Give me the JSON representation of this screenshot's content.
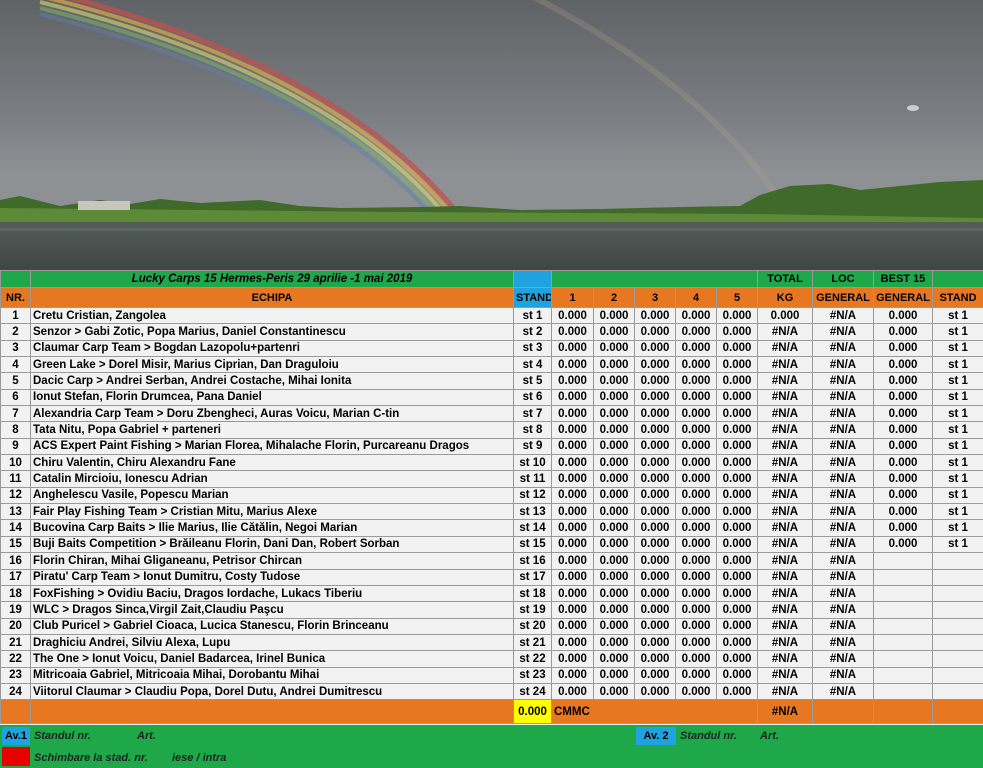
{
  "header": {
    "title": "Lucky Carps 15 Hermes-Peris 29 aprilie -1 mai 2019",
    "total": "TOTAL",
    "loc": "LOC",
    "best": "BEST 15"
  },
  "columns": {
    "nr": "NR.",
    "echipa": "ECHIPA",
    "stand": "STAND",
    "s1": "1",
    "s2": "2",
    "s3": "3",
    "s4": "4",
    "s5": "5",
    "kg": "KG",
    "general1": "GENERAL",
    "general2": "GENERAL",
    "stand2": "STAND"
  },
  "rows": [
    {
      "nr": "1",
      "team": "Cretu Cristian, Zangolea",
      "stand": "st 1",
      "s1": "0.000",
      "s2": "0.000",
      "s3": "0.000",
      "s4": "0.000",
      "s5": "0.000",
      "kg": "0.000",
      "loc": "#N/A",
      "best": "0.000",
      "stand2": "st 1"
    },
    {
      "nr": "2",
      "team": "Senzor > Gabi Zotic, Popa Marius, Daniel Constantinescu",
      "stand": "st 2",
      "s1": "0.000",
      "s2": "0.000",
      "s3": "0.000",
      "s4": "0.000",
      "s5": "0.000",
      "kg": "#N/A",
      "loc": "#N/A",
      "best": "0.000",
      "stand2": "st 1"
    },
    {
      "nr": "3",
      "team": "Claumar Carp Team > Bogdan Lazopolu+partenri",
      "stand": "st 3",
      "s1": "0.000",
      "s2": "0.000",
      "s3": "0.000",
      "s4": "0.000",
      "s5": "0.000",
      "kg": "#N/A",
      "loc": "#N/A",
      "best": "0.000",
      "stand2": "st 1"
    },
    {
      "nr": "4",
      "team": "Green Lake > Dorel Misir, Marius Ciprian, Dan Draguloiu",
      "stand": "st 4",
      "s1": "0.000",
      "s2": "0.000",
      "s3": "0.000",
      "s4": "0.000",
      "s5": "0.000",
      "kg": "#N/A",
      "loc": "#N/A",
      "best": "0.000",
      "stand2": "st 1"
    },
    {
      "nr": "5",
      "team": "Dacic Carp > Andrei Serban, Andrei Costache, Mihai Ionita",
      "stand": "st 5",
      "s1": "0.000",
      "s2": "0.000",
      "s3": "0.000",
      "s4": "0.000",
      "s5": "0.000",
      "kg": "#N/A",
      "loc": "#N/A",
      "best": "0.000",
      "stand2": "st 1"
    },
    {
      "nr": "6",
      "team": "Ionut Stefan, Florin Drumcea, Pana Daniel",
      "stand": "st 6",
      "s1": "0.000",
      "s2": "0.000",
      "s3": "0.000",
      "s4": "0.000",
      "s5": "0.000",
      "kg": "#N/A",
      "loc": "#N/A",
      "best": "0.000",
      "stand2": "st 1"
    },
    {
      "nr": "7",
      "team": "Alexandria Carp Team  > Doru Zbengheci, Auras Voicu, Marian C-tin",
      "stand": "st 7",
      "s1": "0.000",
      "s2": "0.000",
      "s3": "0.000",
      "s4": "0.000",
      "s5": "0.000",
      "kg": "#N/A",
      "loc": "#N/A",
      "best": "0.000",
      "stand2": "st 1"
    },
    {
      "nr": "8",
      "team": "Tata Nitu, Popa Gabriel + parteneri",
      "stand": "st 8",
      "s1": "0.000",
      "s2": "0.000",
      "s3": "0.000",
      "s4": "0.000",
      "s5": "0.000",
      "kg": "#N/A",
      "loc": "#N/A",
      "best": "0.000",
      "stand2": "st 1"
    },
    {
      "nr": "9",
      "team": "ACS Expert Paint Fishing  > Marian Florea, Mihalache Florin, Purcareanu Dragos",
      "stand": "st 9",
      "s1": "0.000",
      "s2": "0.000",
      "s3": "0.000",
      "s4": "0.000",
      "s5": "0.000",
      "kg": "#N/A",
      "loc": "#N/A",
      "best": "0.000",
      "stand2": "st 1"
    },
    {
      "nr": "10",
      "team": "Chiru Valentin, Chiru Alexandru Fane",
      "stand": "st 10",
      "s1": "0.000",
      "s2": "0.000",
      "s3": "0.000",
      "s4": "0.000",
      "s5": "0.000",
      "kg": "#N/A",
      "loc": "#N/A",
      "best": "0.000",
      "stand2": "st 1"
    },
    {
      "nr": "11",
      "team": "Catalin Mircioiu, Ionescu Adrian",
      "stand": "st 11",
      "s1": "0.000",
      "s2": "0.000",
      "s3": "0.000",
      "s4": "0.000",
      "s5": "0.000",
      "kg": "#N/A",
      "loc": "#N/A",
      "best": "0.000",
      "stand2": "st 1"
    },
    {
      "nr": "12",
      "team": "Anghelescu Vasile, Popescu Marian",
      "stand": "st 12",
      "s1": "0.000",
      "s2": "0.000",
      "s3": "0.000",
      "s4": "0.000",
      "s5": "0.000",
      "kg": "#N/A",
      "loc": "#N/A",
      "best": "0.000",
      "stand2": "st 1"
    },
    {
      "nr": "13",
      "team": "Fair Play Fishing Team > Cristian Mitu, Marius Alexe",
      "stand": "st 13",
      "s1": "0.000",
      "s2": "0.000",
      "s3": "0.000",
      "s4": "0.000",
      "s5": "0.000",
      "kg": "#N/A",
      "loc": "#N/A",
      "best": "0.000",
      "stand2": "st 1"
    },
    {
      "nr": "14",
      "team": "Bucovina Carp Baits  > Ilie Marius, Ilie Cătălin, Negoi Marian",
      "stand": "st 14",
      "s1": "0.000",
      "s2": "0.000",
      "s3": "0.000",
      "s4": "0.000",
      "s5": "0.000",
      "kg": "#N/A",
      "loc": "#N/A",
      "best": "0.000",
      "stand2": "st 1"
    },
    {
      "nr": "15",
      "team": "Buji Baits Competition > Brăileanu Florin, Dani Dan, Robert Sorban",
      "stand": "st 15",
      "s1": "0.000",
      "s2": "0.000",
      "s3": "0.000",
      "s4": "0.000",
      "s5": "0.000",
      "kg": "#N/A",
      "loc": "#N/A",
      "best": "0.000",
      "stand2": "st 1"
    },
    {
      "nr": "16",
      "team": "Florin Chiran, Mihai Gliganeanu, Petrisor Chircan",
      "stand": "st 16",
      "s1": "0.000",
      "s2": "0.000",
      "s3": "0.000",
      "s4": "0.000",
      "s5": "0.000",
      "kg": "#N/A",
      "loc": "#N/A",
      "best": "",
      "stand2": ""
    },
    {
      "nr": "17",
      "team": "Piratu' Carp Team  > Ionut Dumitru, Costy Tudose",
      "stand": "st 17",
      "s1": "0.000",
      "s2": "0.000",
      "s3": "0.000",
      "s4": "0.000",
      "s5": "0.000",
      "kg": "#N/A",
      "loc": "#N/A",
      "best": "",
      "stand2": ""
    },
    {
      "nr": "18",
      "team": "FoxFishing > Ovidiu Baciu, Dragos Iordache, Lukacs Tiberiu",
      "stand": "st 18",
      "s1": "0.000",
      "s2": "0.000",
      "s3": "0.000",
      "s4": "0.000",
      "s5": "0.000",
      "kg": "#N/A",
      "loc": "#N/A",
      "best": "",
      "stand2": ""
    },
    {
      "nr": "19",
      "team": "WLC > Dragos Sinca,Virgil Zait,Claudiu Paşcu",
      "stand": "st 19",
      "s1": "0.000",
      "s2": "0.000",
      "s3": "0.000",
      "s4": "0.000",
      "s5": "0.000",
      "kg": "#N/A",
      "loc": "#N/A",
      "best": "",
      "stand2": ""
    },
    {
      "nr": "20",
      "team": "Club Puricel  > Gabriel Cioaca, Lucica Stanescu, Florin Brinceanu",
      "stand": "st 20",
      "s1": "0.000",
      "s2": "0.000",
      "s3": "0.000",
      "s4": "0.000",
      "s5": "0.000",
      "kg": "#N/A",
      "loc": "#N/A",
      "best": "",
      "stand2": ""
    },
    {
      "nr": "21",
      "team": "Draghiciu Andrei, Silviu Alexa, Lupu",
      "stand": "st 21",
      "s1": "0.000",
      "s2": "0.000",
      "s3": "0.000",
      "s4": "0.000",
      "s5": "0.000",
      "kg": "#N/A",
      "loc": "#N/A",
      "best": "",
      "stand2": ""
    },
    {
      "nr": "22",
      "team": "The One  > Ionut Voicu, Daniel Badarcea, Irinel Bunica",
      "stand": "st 22",
      "s1": "0.000",
      "s2": "0.000",
      "s3": "0.000",
      "s4": "0.000",
      "s5": "0.000",
      "kg": "#N/A",
      "loc": "#N/A",
      "best": "",
      "stand2": ""
    },
    {
      "nr": "23",
      "team": "Mitricoaia Gabriel, Mitricoaia Mihai, Dorobantu Mihai",
      "stand": "st 23",
      "s1": "0.000",
      "s2": "0.000",
      "s3": "0.000",
      "s4": "0.000",
      "s5": "0.000",
      "kg": "#N/A",
      "loc": "#N/A",
      "best": "",
      "stand2": ""
    },
    {
      "nr": "24",
      "team": "Viitorul Claumar > Claudiu Popa, Dorel Dutu, Andrei Dumitrescu",
      "stand": "st 24",
      "s1": "0.000",
      "s2": "0.000",
      "s3": "0.000",
      "s4": "0.000",
      "s5": "0.000",
      "kg": "#N/A",
      "loc": "#N/A",
      "best": "",
      "stand2": ""
    }
  ],
  "summary": {
    "value": "0.000",
    "label": "CMMC",
    "kg": "#N/A"
  },
  "footer": {
    "av1": "Av.1",
    "standul1": "Standul nr.",
    "art1": "Art.",
    "av2": "Av. 2",
    "standul2": "Standul  nr.",
    "art2": "Art.",
    "schimbare": "Schimbare la stad.  nr.",
    "iese": "iese / intra"
  },
  "colors": {
    "green": "#1ea84a",
    "orange": "#e87722",
    "blue": "#1fa2e0",
    "yellow": "#ffff00",
    "red": "#e60000"
  }
}
